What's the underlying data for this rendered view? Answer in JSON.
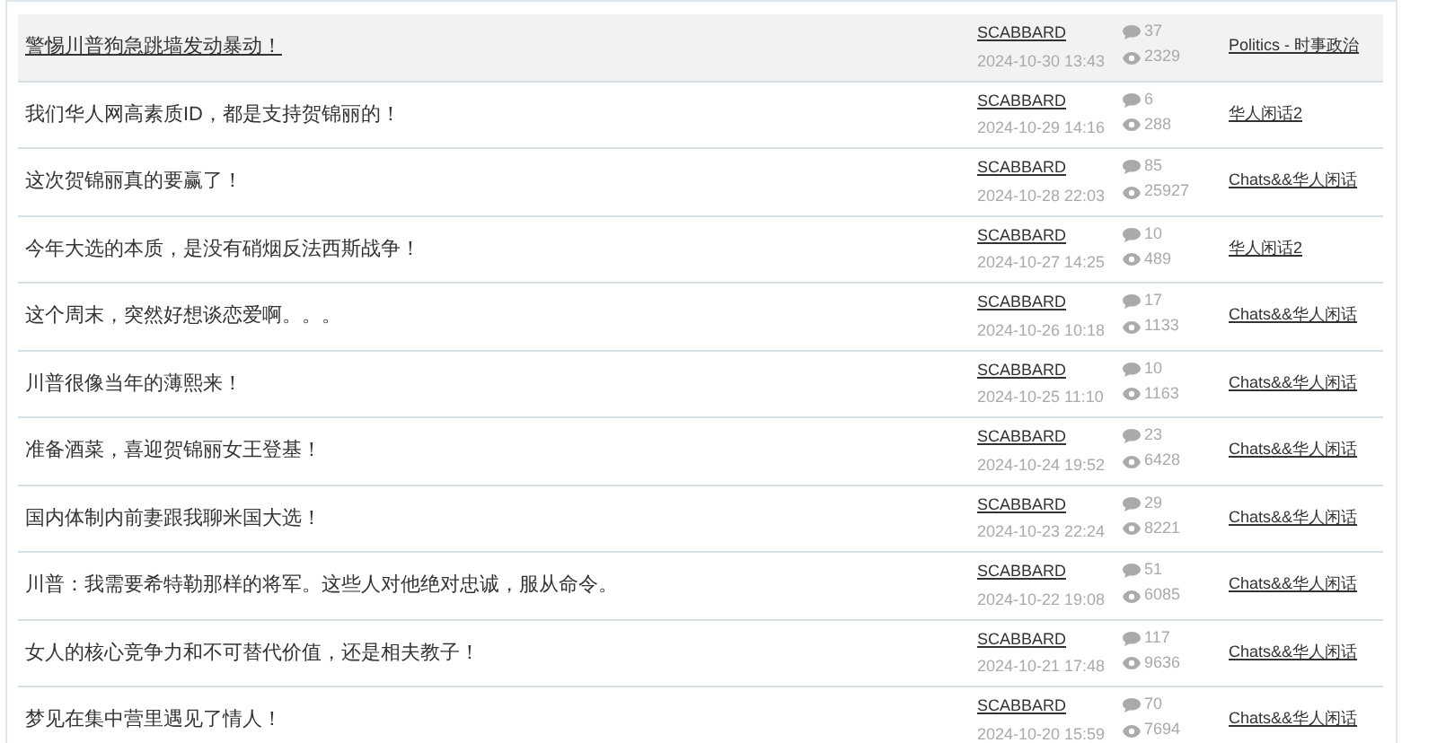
{
  "topics": [
    {
      "title": "警惕川普狗急跳墙发动暴动！",
      "author": "SCABBARD",
      "date": "2024-10-30 13:43",
      "replies": "37",
      "views": "2329",
      "category": "Politics - 时事政治",
      "selected": true
    },
    {
      "title": "我们华人网高素质ID，都是支持贺锦丽的！",
      "author": "SCABBARD",
      "date": "2024-10-29 14:16",
      "replies": "6",
      "views": "288",
      "category": "华人闲话2",
      "selected": false
    },
    {
      "title": "这次贺锦丽真的要赢了！",
      "author": "SCABBARD",
      "date": "2024-10-28 22:03",
      "replies": "85",
      "views": "25927",
      "category": "Chats&&华人闲话",
      "selected": false
    },
    {
      "title": "今年大选的本质，是没有硝烟反法西斯战争！",
      "author": "SCABBARD",
      "date": "2024-10-27 14:25",
      "replies": "10",
      "views": "489",
      "category": "华人闲话2",
      "selected": false
    },
    {
      "title": "这个周末，突然好想谈恋爱啊。。。",
      "author": "SCABBARD",
      "date": "2024-10-26 10:18",
      "replies": "17",
      "views": "1133",
      "category": "Chats&&华人闲话",
      "selected": false
    },
    {
      "title": "川普很像当年的薄熙来！",
      "author": "SCABBARD",
      "date": "2024-10-25 11:10",
      "replies": "10",
      "views": "1163",
      "category": "Chats&&华人闲话",
      "selected": false
    },
    {
      "title": "准备酒菜，喜迎贺锦丽女王登基！",
      "author": "SCABBARD",
      "date": "2024-10-24 19:52",
      "replies": "23",
      "views": "6428",
      "category": "Chats&&华人闲话",
      "selected": false
    },
    {
      "title": "国内体制内前妻跟我聊米国大选！",
      "author": "SCABBARD",
      "date": "2024-10-23 22:24",
      "replies": "29",
      "views": "8221",
      "category": "Chats&&华人闲话",
      "selected": false
    },
    {
      "title": "川普：我需要希特勒那样的将军。这些人对他绝对忠诚，服从命令。",
      "author": "SCABBARD",
      "date": "2024-10-22 19:08",
      "replies": "51",
      "views": "6085",
      "category": "Chats&&华人闲话",
      "selected": false
    },
    {
      "title": "女人的核心竞争力和不可替代价值，还是相夫教子！",
      "author": "SCABBARD",
      "date": "2024-10-21 17:48",
      "replies": "117",
      "views": "9636",
      "category": "Chats&&华人闲话",
      "selected": false
    },
    {
      "title": "梦见在集中营里遇见了情人！",
      "author": "SCABBARD",
      "date": "2024-10-20 15:59",
      "replies": "70",
      "views": "7694",
      "category": "Chats&&华人闲话",
      "selected": false
    }
  ]
}
